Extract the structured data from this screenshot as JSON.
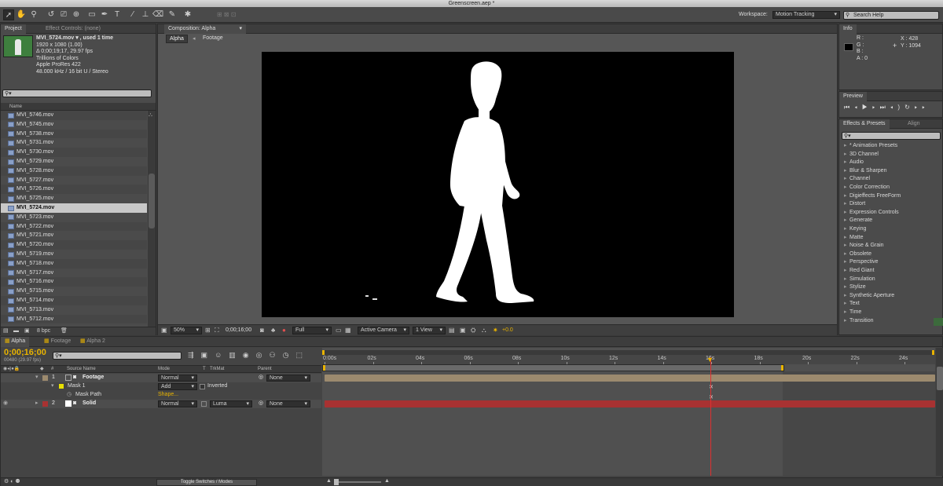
{
  "window": {
    "title": "Greenscreen.aep *"
  },
  "toolbar": {
    "workspace_label": "Workspace:",
    "workspace_value": "Motion Tracking",
    "search_placeholder": "Search Help"
  },
  "project": {
    "tabs": [
      "Project",
      "Effect Controls: (none)"
    ],
    "selected_file": {
      "name": "MVI_5724.mov ▾ , used 1 time",
      "line1": "1920 x 1080 (1.00)",
      "line2": "Δ 0;00;19;17, 29.97 fps",
      "line3": "Trillions of Colors",
      "line4": "Apple ProRes 422",
      "line5": "48.000 kHz / 16 bit U / Stereo"
    },
    "column_name": "Name",
    "files": [
      "MVI_5746.mov",
      "MVI_5745.mov",
      "MVI_5738.mov",
      "MVI_5731.mov",
      "MVI_5730.mov",
      "MVI_5729.mov",
      "MVI_5728.mov",
      "MVI_5727.mov",
      "MVI_5726.mov",
      "MVI_5725.mov",
      "MVI_5724.mov",
      "MVI_5723.mov",
      "MVI_5722.mov",
      "MVI_5721.mov",
      "MVI_5720.mov",
      "MVI_5719.mov",
      "MVI_5718.mov",
      "MVI_5717.mov",
      "MVI_5716.mov",
      "MVI_5715.mov",
      "MVI_5714.mov",
      "MVI_5713.mov",
      "MVI_5712.mov"
    ],
    "bpc": "8 bpc"
  },
  "composition": {
    "tab": "Composition: Alpha",
    "breadcrumbs": [
      "Alpha",
      "Footage"
    ],
    "bottom": {
      "zoom": "50%",
      "timecode": "0;00;16;00",
      "resolution": "Full",
      "camera": "Active Camera",
      "view": "1 View",
      "exposure": "+0.0"
    }
  },
  "info": {
    "tab": "Info",
    "r": "R :",
    "g": "G :",
    "b": "B :",
    "a": "A : 0",
    "x": "X : 428",
    "y": "Y : 1094"
  },
  "preview": {
    "tab": "Preview"
  },
  "effects": {
    "tabs": [
      "Effects & Presets",
      "Align"
    ],
    "items": [
      "* Animation Presets",
      "3D Channel",
      "Audio",
      "Blur & Sharpen",
      "Channel",
      "Color Correction",
      "Digieffects FreeForm",
      "Distort",
      "Expression Controls",
      "Generate",
      "Keying",
      "Matte",
      "Noise & Grain",
      "Obsolete",
      "Perspective",
      "Red Giant",
      "Simulation",
      "Stylize",
      "Synthetic Aperture",
      "Text",
      "Time",
      "Transition"
    ]
  },
  "timeline": {
    "tabs": [
      "Alpha",
      "Footage",
      "Alpha 2"
    ],
    "current_time": "0;00;16;00",
    "frame_info": "00480 (29.97 fps)",
    "columns": {
      "source_name": "Source Name",
      "mode": "Mode",
      "t": "T",
      "trkmat": "TrkMat",
      "parent": "Parent",
      "num": "#"
    },
    "layers": [
      {
        "num": "1",
        "name": "Footage",
        "mode": "Normal",
        "trkmat": "",
        "parent": "None"
      },
      {
        "num": "2",
        "name": "Solid",
        "mode": "Normal",
        "trkmat": "Luma",
        "parent": "None"
      }
    ],
    "mask": {
      "name": "Mask 1",
      "mode": "Add",
      "inverted_label": "Inverted",
      "path_label": "Mask Path",
      "path_value": "Shape..."
    },
    "ruler": [
      "0:00s",
      "02s",
      "04s",
      "06s",
      "08s",
      "10s",
      "12s",
      "14s",
      "16s",
      "18s",
      "20s",
      "22s",
      "24s"
    ],
    "toggle_label": "Toggle Switches / Modes"
  },
  "colors": {
    "accent": "#e8b300",
    "footage_bar": "#9c8a6e",
    "solid_bar": "#a83232",
    "playhead": "#e03030"
  }
}
